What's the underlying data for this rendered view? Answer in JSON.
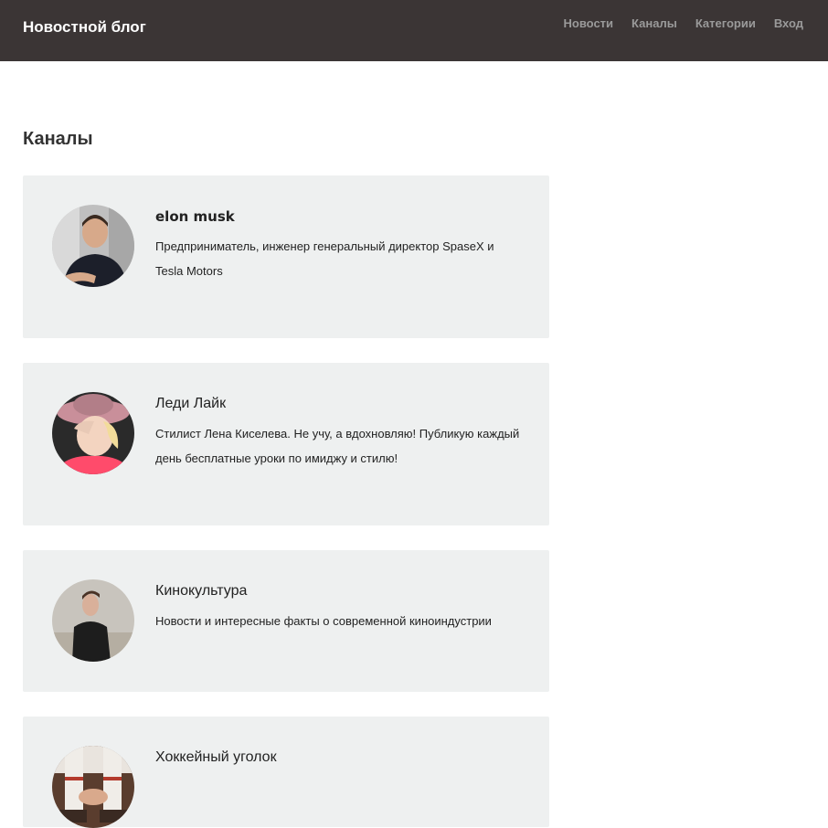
{
  "header": {
    "brand": "Новостной блог",
    "nav": [
      "Новости",
      "Каналы",
      "Категории",
      "Вход"
    ]
  },
  "page": {
    "title": "Каналы"
  },
  "channels": [
    {
      "name": "elon musk",
      "description": "Предприниматель, инженер генеральный директор SpaseX и Tesla Motors"
    },
    {
      "name": "Леди Лайк",
      "description": "Стилист Лена Киселева. Не учу, а вдохновляю! Публикую каждый день бесплатные уроки по имиджу и стилю!"
    },
    {
      "name": "Кинокультура",
      "description": "Новости и интересные факты о современной киноиндустрии"
    },
    {
      "name": "Хоккейный уголок",
      "description": ""
    }
  ],
  "colors": {
    "navbar_bg": "#3b3535",
    "nav_link": "#9a9a9a",
    "card_bg": "#eef0f0"
  }
}
